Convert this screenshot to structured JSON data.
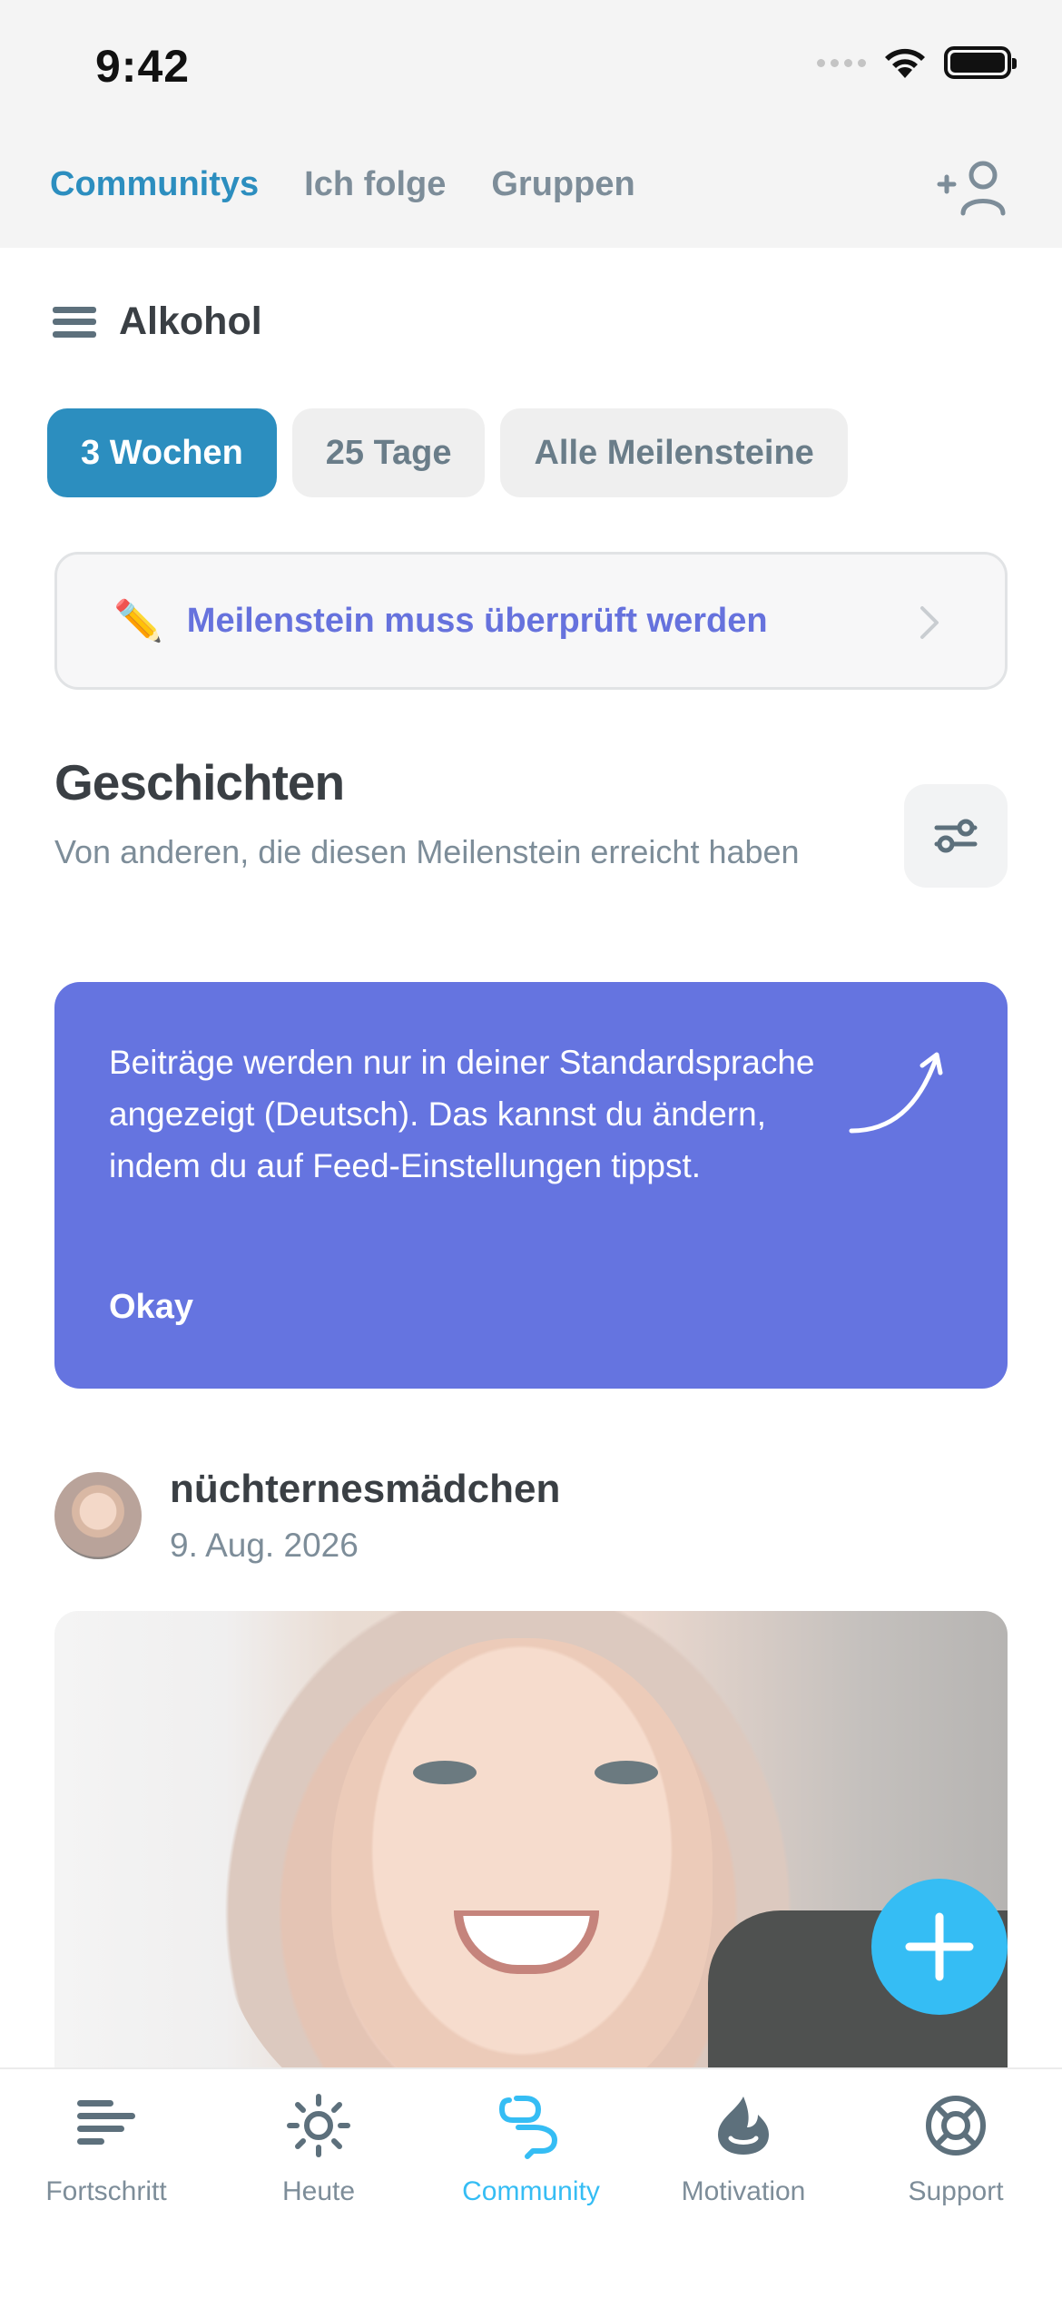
{
  "status_bar": {
    "time": "9:42"
  },
  "top_tabs": [
    {
      "label": "Communitys",
      "active": true
    },
    {
      "label": "Ich folge",
      "active": false
    },
    {
      "label": "Gruppen",
      "active": false
    }
  ],
  "section": {
    "title": "Alkohol"
  },
  "milestone_chips": [
    {
      "label": "3 Wochen",
      "active": true
    },
    {
      "label": "25 Tage",
      "active": false
    },
    {
      "label": "Alle Meilensteine",
      "active": false
    }
  ],
  "review_banner": {
    "icon": "✏️",
    "text": "Meilenstein muss überprüft werden"
  },
  "stories": {
    "title": "Geschichten",
    "subtitle": "Von anderen, die diesen Meilenstein erreicht haben"
  },
  "info_card": {
    "message": "Beiträge werden nur in deiner Standardsprache angezeigt (Deutsch). Das kannst du ändern, indem du auf Feed-Einstellungen tippst.",
    "button": "Okay",
    "color": "#6574e0"
  },
  "post": {
    "username": "nüchternesmädchen",
    "date": "9. Aug. 2026"
  },
  "bottom_tabs": [
    {
      "label": "Fortschritt",
      "icon": "progress-bars-icon",
      "active": false
    },
    {
      "label": "Heute",
      "icon": "sun-icon",
      "active": false
    },
    {
      "label": "Community",
      "icon": "chat-bubbles-icon",
      "active": true
    },
    {
      "label": "Motivation",
      "icon": "flame-icon",
      "active": false
    },
    {
      "label": "Support",
      "icon": "lifebuoy-icon",
      "active": false
    }
  ],
  "colors": {
    "accent": "#2c8ebf",
    "fab": "#35bdf4",
    "highlight": "#6672dd"
  }
}
